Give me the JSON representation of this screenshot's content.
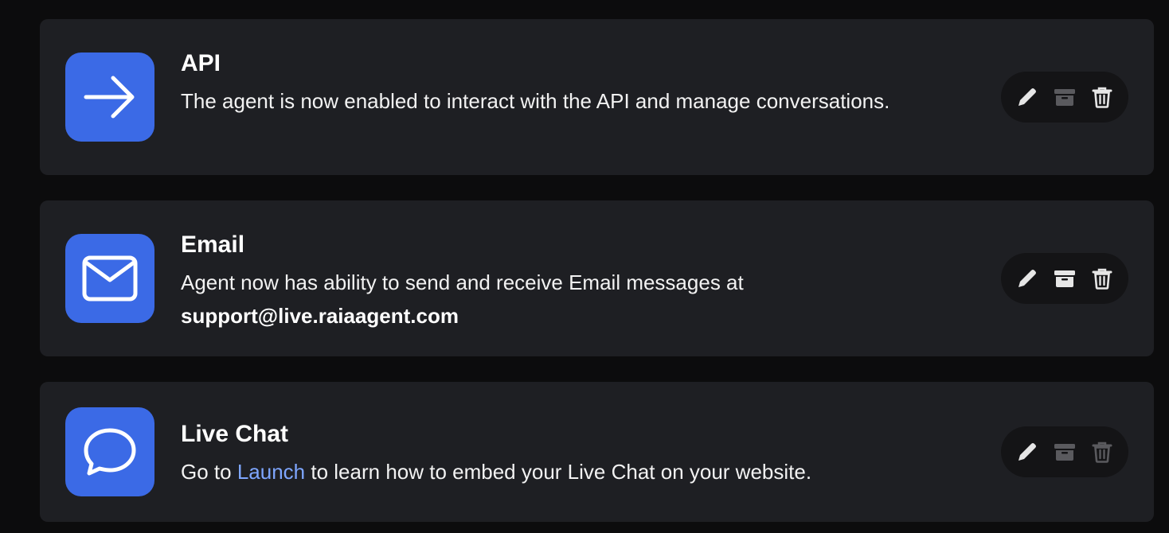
{
  "integrations": [
    {
      "title": "API",
      "icon": "arrow-right-icon",
      "description": "The agent is now enabled to interact with the API and manage conversations.",
      "actions": {
        "edit": "pencil-icon",
        "archive": "archive-icon",
        "delete": "trash-icon"
      }
    },
    {
      "title": "Email",
      "icon": "envelope-icon",
      "description_prefix": "Agent now has ability to send and receive Email messages at",
      "email_address": "support@live.raiaagent.com",
      "actions": {
        "edit": "pencil-icon",
        "archive": "archive-icon",
        "delete": "trash-icon"
      }
    },
    {
      "title": "Live Chat",
      "icon": "chat-bubble-icon",
      "description_prefix": "Go to",
      "link_text": "Launch",
      "description_suffix": "to learn how to embed your Live Chat on your website.",
      "actions": {
        "edit": "pencil-icon",
        "archive": "archive-icon",
        "delete": "trash-icon"
      }
    }
  ],
  "colors": {
    "background": "#0c0c0d",
    "card": "#1e1f23",
    "icon_tile": "#3b6ae6",
    "action_pill": "#141416",
    "link": "#7ea6ff",
    "action_icon_active": "#e6e6e6",
    "action_icon_muted": "#5a5a5e"
  }
}
